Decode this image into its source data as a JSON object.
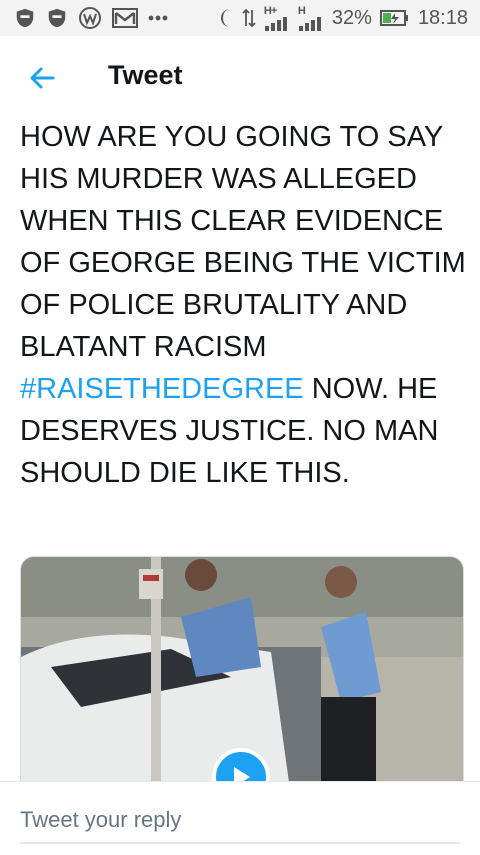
{
  "status_bar": {
    "left_icons": [
      "shield-icon",
      "shield-icon",
      "wordpress-icon",
      "gmail-icon",
      "more-dots-icon"
    ],
    "network_1": "H+",
    "network_2": "H",
    "battery": "32%",
    "time": "18:18"
  },
  "app_bar": {
    "title": "Tweet"
  },
  "tweet": {
    "text_before": "HOW ARE YOU GOING TO SAY HIS MURDER WAS ALLEGED WHEN THIS CLEAR EVIDENCE OF GEORGE BEING THE VICTIM OF POLICE BRUTALITY AND BLATANT RACISM ",
    "hashtag": "#RAISETHEDEGREE",
    "text_after": " NOW. HE DESERVES JUSTICE. NO MAN SHOULD DIE LIKE THIS."
  },
  "reply": {
    "placeholder": "Tweet your reply"
  },
  "colors": {
    "accent": "#1da1f2",
    "text": "#14171a",
    "muted": "#657786"
  }
}
